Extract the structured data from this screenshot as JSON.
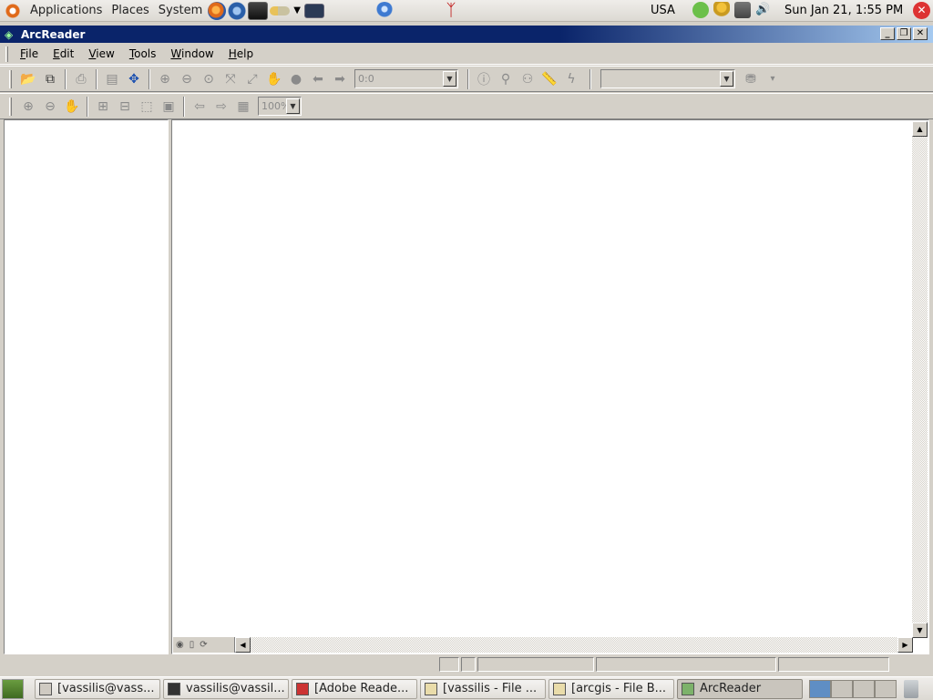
{
  "top_panel": {
    "menus": [
      "Applications",
      "Places",
      "System"
    ],
    "keyboard_layout": "USA",
    "clock": "Sun Jan 21,  1:55 PM"
  },
  "window": {
    "title": "ArcReader",
    "buttons": [
      "minimize",
      "restore",
      "close"
    ]
  },
  "menubar": {
    "items": [
      {
        "key": "F",
        "rest": "ile"
      },
      {
        "key": "E",
        "rest": "dit"
      },
      {
        "key": "V",
        "rest": "iew"
      },
      {
        "key": "T",
        "rest": "ools"
      },
      {
        "key": "W",
        "rest": "indow"
      },
      {
        "key": "H",
        "rest": "elp"
      }
    ]
  },
  "toolbar": {
    "scale_combo_value": "0:0",
    "layer_combo_value": "",
    "zoom_combo_value": "100%"
  },
  "taskbar": {
    "tasks": [
      "[vassilis@vass...",
      "vassilis@vassil...",
      "[Adobe Reade...",
      "[vassilis - File ...",
      "[arcgis - File B...",
      "ArcReader"
    ],
    "active_task": "ArcReader"
  },
  "icons": {
    "title": "arcreader-app-icon",
    "open": "open-folder-icon",
    "copy": "copy-icon",
    "print": "print-icon"
  }
}
